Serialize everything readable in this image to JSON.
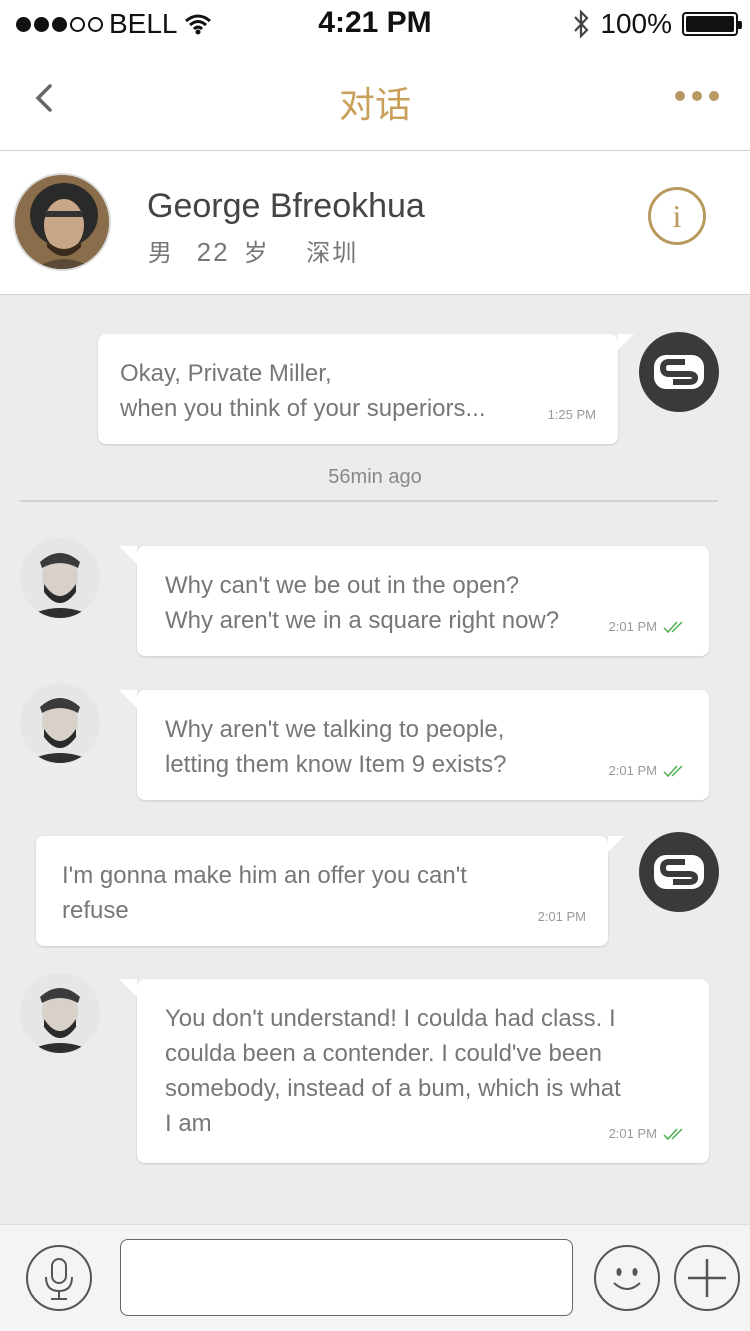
{
  "status_bar": {
    "carrier": "BELL",
    "time": "4:21 PM",
    "battery": "100%",
    "signal_bars_filled": 3,
    "signal_bars_total": 5
  },
  "nav": {
    "title": "对话",
    "back_icon": "chevron-left-icon",
    "more_icon": "more-dots-icon"
  },
  "contact": {
    "name": "George Bfreokhua",
    "gender": "男",
    "age": "22",
    "age_unit": "岁",
    "city": "深圳",
    "info_label": "i"
  },
  "messages": [
    {
      "sender": "self",
      "lines": [
        "Okay, Private Miller,",
        "when you think of your superiors..."
      ],
      "time": "1:25 PM"
    },
    {
      "sender": "contact",
      "lines": [
        "Why can't we be out in the open?",
        "Why aren't we in a square right now?"
      ],
      "time": "2:01 PM",
      "read": true
    },
    {
      "sender": "contact",
      "lines": [
        "Why aren't we talking to people,",
        "letting them know Item 9 exists?"
      ],
      "time": "2:01 PM",
      "read": true
    },
    {
      "sender": "self",
      "lines": [
        "I'm gonna make him an offer you can't",
        "refuse"
      ],
      "time": "2:01 PM"
    },
    {
      "sender": "contact",
      "lines": [
        "You don't understand! I coulda had class. I",
        "coulda been a contender. I could've been",
        "somebody, instead of a bum, which is what",
        "I am"
      ],
      "time": "2:01 PM",
      "read": true
    }
  ],
  "divider": {
    "label": "56min ago"
  },
  "input_bar": {
    "voice_icon": "microphone-icon",
    "message_value": "",
    "emoji_icon": "smiley-icon",
    "add_icon": "plus-icon"
  },
  "colors": {
    "accent": "#c9a05a",
    "read_check": "#4caf50",
    "background": "#ececec"
  }
}
